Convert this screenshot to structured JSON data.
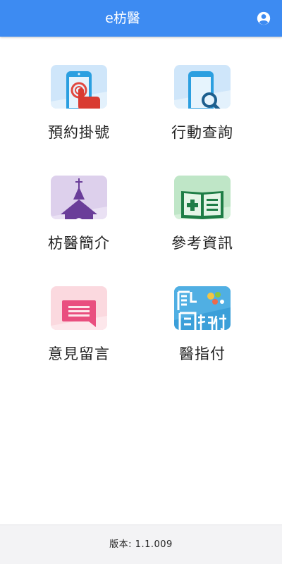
{
  "header": {
    "title": "e枋醫",
    "account_icon": "account-circle-icon",
    "background": "#3d8bf2"
  },
  "tiles": [
    {
      "label": "預約掛號",
      "icon": "phone-touch-icon"
    },
    {
      "label": "行動查詢",
      "icon": "phone-search-icon"
    },
    {
      "label": "枋醫簡介",
      "icon": "church-icon"
    },
    {
      "label": "參考資訊",
      "icon": "medical-book-icon"
    },
    {
      "label": "意見留言",
      "icon": "message-icon"
    },
    {
      "label": "醫指付",
      "icon": "yi-zhi-fu-logo-icon"
    }
  ],
  "footer": {
    "version_text": "版本: 1.1.009"
  }
}
